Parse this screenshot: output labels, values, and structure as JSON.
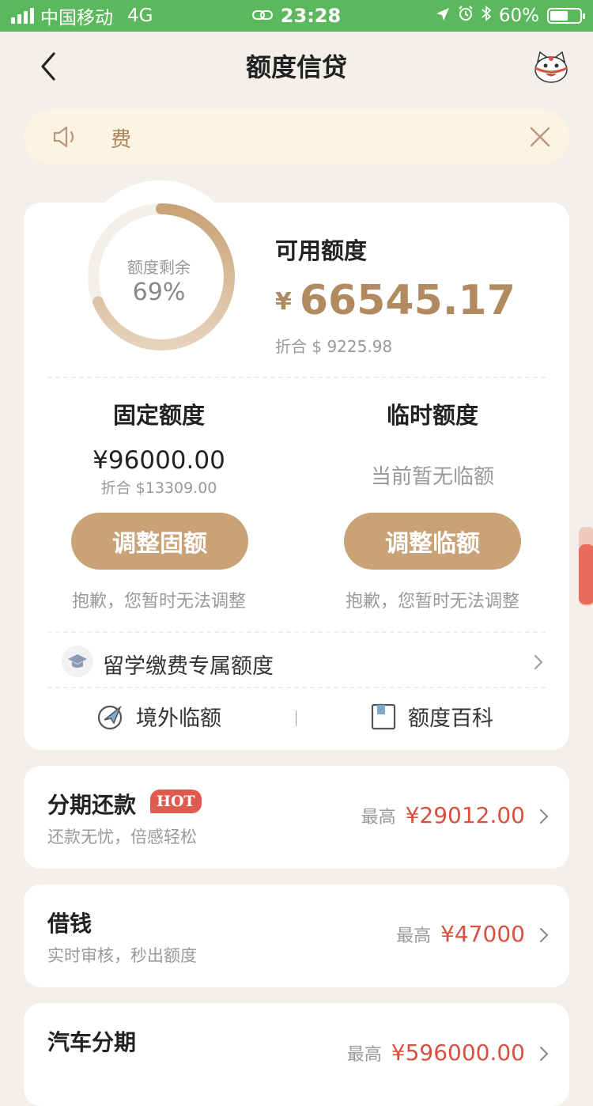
{
  "status_bar": {
    "carrier": "中国移动",
    "network": "4G",
    "time": "23:28",
    "battery": "60%",
    "battery_level": 0.6
  },
  "nav": {
    "title": "额度信贷"
  },
  "notice": {
    "text": "费"
  },
  "credit": {
    "ring_label": "额度剩余",
    "ring_value": "69%",
    "ring_fraction": 0.69,
    "available_title": "可用额度",
    "currency_symbol": "¥",
    "available_amount": "66545.17",
    "available_usd": "折合 $ 9225.98"
  },
  "fixed": {
    "title": "固定额度",
    "amount": "¥96000.00",
    "usd": "折合 $13309.00",
    "button": "调整固额",
    "note": "抱歉，您暂时无法调整"
  },
  "temporary": {
    "title": "临时额度",
    "none_text": "当前暂无临额",
    "button": "调整临额",
    "note": "抱歉，您暂时无法调整"
  },
  "study_abroad": {
    "label": "留学缴费专属额度"
  },
  "links": {
    "overseas": "境外临额",
    "wiki": "额度百科"
  },
  "products": [
    {
      "name": "分期还款",
      "badge": "HOT",
      "sub": "还款无忧，倍感轻松",
      "max_label": "最高",
      "max_value": "¥29012.00"
    },
    {
      "name": "借钱",
      "badge": "",
      "sub": "实时审核，秒出额度",
      "max_label": "最高",
      "max_value": "¥47000"
    },
    {
      "name": "汽车分期",
      "badge": "",
      "sub": "",
      "max_label": "最高",
      "max_value": "¥596000.00"
    }
  ],
  "colors": {
    "status_green": "#5cb85c",
    "gold": "#c9a277",
    "amount_gold": "#b18a5f",
    "red": "#d9503f"
  }
}
